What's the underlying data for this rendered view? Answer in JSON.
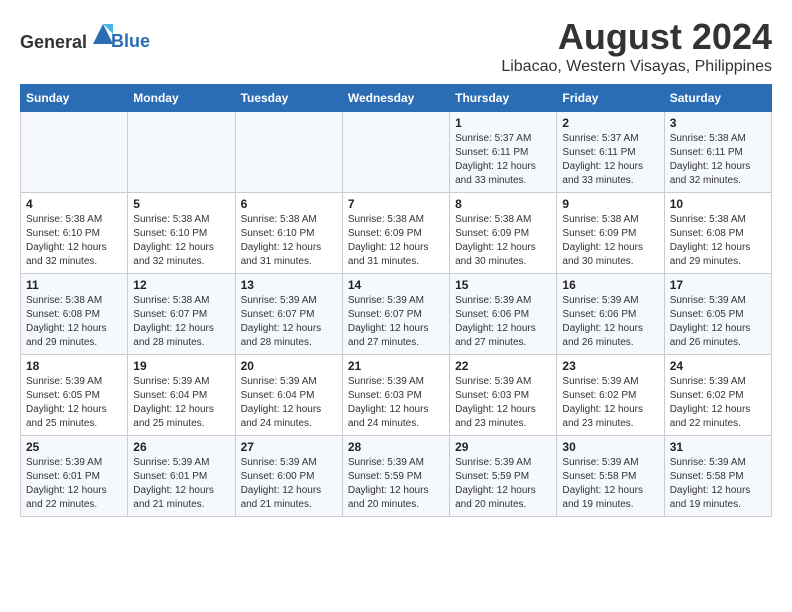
{
  "logo": {
    "text_general": "General",
    "text_blue": "Blue"
  },
  "header": {
    "title": "August 2024",
    "subtitle": "Libacao, Western Visayas, Philippines"
  },
  "weekdays": [
    "Sunday",
    "Monday",
    "Tuesday",
    "Wednesday",
    "Thursday",
    "Friday",
    "Saturday"
  ],
  "weeks": [
    [
      {
        "day": "",
        "sunrise": "",
        "sunset": "",
        "daylight": ""
      },
      {
        "day": "",
        "sunrise": "",
        "sunset": "",
        "daylight": ""
      },
      {
        "day": "",
        "sunrise": "",
        "sunset": "",
        "daylight": ""
      },
      {
        "day": "",
        "sunrise": "",
        "sunset": "",
        "daylight": ""
      },
      {
        "day": "1",
        "sunrise": "Sunrise: 5:37 AM",
        "sunset": "Sunset: 6:11 PM",
        "daylight": "Daylight: 12 hours and 33 minutes."
      },
      {
        "day": "2",
        "sunrise": "Sunrise: 5:37 AM",
        "sunset": "Sunset: 6:11 PM",
        "daylight": "Daylight: 12 hours and 33 minutes."
      },
      {
        "day": "3",
        "sunrise": "Sunrise: 5:38 AM",
        "sunset": "Sunset: 6:11 PM",
        "daylight": "Daylight: 12 hours and 32 minutes."
      }
    ],
    [
      {
        "day": "4",
        "sunrise": "Sunrise: 5:38 AM",
        "sunset": "Sunset: 6:10 PM",
        "daylight": "Daylight: 12 hours and 32 minutes."
      },
      {
        "day": "5",
        "sunrise": "Sunrise: 5:38 AM",
        "sunset": "Sunset: 6:10 PM",
        "daylight": "Daylight: 12 hours and 32 minutes."
      },
      {
        "day": "6",
        "sunrise": "Sunrise: 5:38 AM",
        "sunset": "Sunset: 6:10 PM",
        "daylight": "Daylight: 12 hours and 31 minutes."
      },
      {
        "day": "7",
        "sunrise": "Sunrise: 5:38 AM",
        "sunset": "Sunset: 6:09 PM",
        "daylight": "Daylight: 12 hours and 31 minutes."
      },
      {
        "day": "8",
        "sunrise": "Sunrise: 5:38 AM",
        "sunset": "Sunset: 6:09 PM",
        "daylight": "Daylight: 12 hours and 30 minutes."
      },
      {
        "day": "9",
        "sunrise": "Sunrise: 5:38 AM",
        "sunset": "Sunset: 6:09 PM",
        "daylight": "Daylight: 12 hours and 30 minutes."
      },
      {
        "day": "10",
        "sunrise": "Sunrise: 5:38 AM",
        "sunset": "Sunset: 6:08 PM",
        "daylight": "Daylight: 12 hours and 29 minutes."
      }
    ],
    [
      {
        "day": "11",
        "sunrise": "Sunrise: 5:38 AM",
        "sunset": "Sunset: 6:08 PM",
        "daylight": "Daylight: 12 hours and 29 minutes."
      },
      {
        "day": "12",
        "sunrise": "Sunrise: 5:38 AM",
        "sunset": "Sunset: 6:07 PM",
        "daylight": "Daylight: 12 hours and 28 minutes."
      },
      {
        "day": "13",
        "sunrise": "Sunrise: 5:39 AM",
        "sunset": "Sunset: 6:07 PM",
        "daylight": "Daylight: 12 hours and 28 minutes."
      },
      {
        "day": "14",
        "sunrise": "Sunrise: 5:39 AM",
        "sunset": "Sunset: 6:07 PM",
        "daylight": "Daylight: 12 hours and 27 minutes."
      },
      {
        "day": "15",
        "sunrise": "Sunrise: 5:39 AM",
        "sunset": "Sunset: 6:06 PM",
        "daylight": "Daylight: 12 hours and 27 minutes."
      },
      {
        "day": "16",
        "sunrise": "Sunrise: 5:39 AM",
        "sunset": "Sunset: 6:06 PM",
        "daylight": "Daylight: 12 hours and 26 minutes."
      },
      {
        "day": "17",
        "sunrise": "Sunrise: 5:39 AM",
        "sunset": "Sunset: 6:05 PM",
        "daylight": "Daylight: 12 hours and 26 minutes."
      }
    ],
    [
      {
        "day": "18",
        "sunrise": "Sunrise: 5:39 AM",
        "sunset": "Sunset: 6:05 PM",
        "daylight": "Daylight: 12 hours and 25 minutes."
      },
      {
        "day": "19",
        "sunrise": "Sunrise: 5:39 AM",
        "sunset": "Sunset: 6:04 PM",
        "daylight": "Daylight: 12 hours and 25 minutes."
      },
      {
        "day": "20",
        "sunrise": "Sunrise: 5:39 AM",
        "sunset": "Sunset: 6:04 PM",
        "daylight": "Daylight: 12 hours and 24 minutes."
      },
      {
        "day": "21",
        "sunrise": "Sunrise: 5:39 AM",
        "sunset": "Sunset: 6:03 PM",
        "daylight": "Daylight: 12 hours and 24 minutes."
      },
      {
        "day": "22",
        "sunrise": "Sunrise: 5:39 AM",
        "sunset": "Sunset: 6:03 PM",
        "daylight": "Daylight: 12 hours and 23 minutes."
      },
      {
        "day": "23",
        "sunrise": "Sunrise: 5:39 AM",
        "sunset": "Sunset: 6:02 PM",
        "daylight": "Daylight: 12 hours and 23 minutes."
      },
      {
        "day": "24",
        "sunrise": "Sunrise: 5:39 AM",
        "sunset": "Sunset: 6:02 PM",
        "daylight": "Daylight: 12 hours and 22 minutes."
      }
    ],
    [
      {
        "day": "25",
        "sunrise": "Sunrise: 5:39 AM",
        "sunset": "Sunset: 6:01 PM",
        "daylight": "Daylight: 12 hours and 22 minutes."
      },
      {
        "day": "26",
        "sunrise": "Sunrise: 5:39 AM",
        "sunset": "Sunset: 6:01 PM",
        "daylight": "Daylight: 12 hours and 21 minutes."
      },
      {
        "day": "27",
        "sunrise": "Sunrise: 5:39 AM",
        "sunset": "Sunset: 6:00 PM",
        "daylight": "Daylight: 12 hours and 21 minutes."
      },
      {
        "day": "28",
        "sunrise": "Sunrise: 5:39 AM",
        "sunset": "Sunset: 5:59 PM",
        "daylight": "Daylight: 12 hours and 20 minutes."
      },
      {
        "day": "29",
        "sunrise": "Sunrise: 5:39 AM",
        "sunset": "Sunset: 5:59 PM",
        "daylight": "Daylight: 12 hours and 20 minutes."
      },
      {
        "day": "30",
        "sunrise": "Sunrise: 5:39 AM",
        "sunset": "Sunset: 5:58 PM",
        "daylight": "Daylight: 12 hours and 19 minutes."
      },
      {
        "day": "31",
        "sunrise": "Sunrise: 5:39 AM",
        "sunset": "Sunset: 5:58 PM",
        "daylight": "Daylight: 12 hours and 19 minutes."
      }
    ]
  ]
}
